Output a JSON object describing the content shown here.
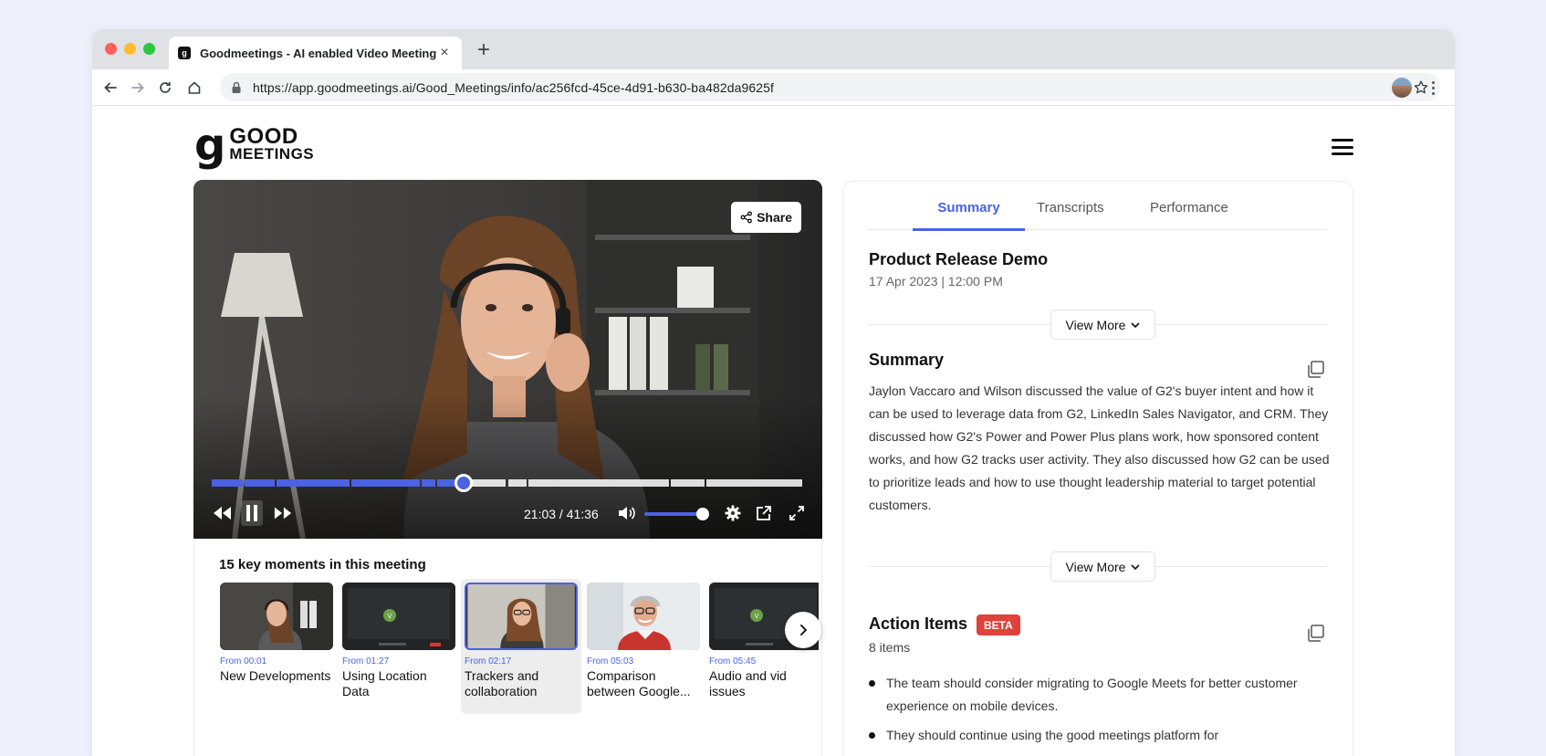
{
  "browser": {
    "tab_title": "Goodmeetings - AI enabled Video Meetings",
    "favicon_letter": "g",
    "tab_close": "×",
    "new_tab": "+",
    "url": "https://app.goodmeetings.ai/Good_Meetings/info/ac256fcd-45ce-4d91-b630-ba482da9625f"
  },
  "brand": {
    "mark": "g",
    "line1": "GOOD",
    "line2": "MEETINGS"
  },
  "video": {
    "share_label": "Share",
    "time": "21:03 / 41:36",
    "progress_fraction": 0.425,
    "volume_fraction": 0.9,
    "accent_color": "#4a62e3"
  },
  "moments": {
    "title": "15 key moments in this meeting",
    "items": [
      {
        "from": "From 00:01",
        "label": "New Developments",
        "thumb": "woman-headset"
      },
      {
        "from": "From 01:27",
        "label": "Using Location Data",
        "thumb": "screen-share"
      },
      {
        "from": "From 02:17",
        "label": "Trackers and collaboration",
        "thumb": "woman-glasses",
        "active": true
      },
      {
        "from": "From 05:03",
        "label": "Comparison between Google...",
        "thumb": "man-glasses"
      },
      {
        "from": "From 05:45",
        "label": "Audio and vid issues",
        "thumb": "screen-share"
      }
    ]
  },
  "panel": {
    "tabs": [
      "Summary",
      "Transcripts",
      "Performance"
    ],
    "active_tab": "Summary",
    "meeting_title": "Product Release Demo",
    "meeting_date": "17 Apr 2023 | 12:00 PM",
    "view_more": "View More",
    "summary_heading": "Summary",
    "summary_text": "Jaylon Vaccaro and Wilson discussed the value of G2's buyer intent and how it can be used to leverage data from G2, LinkedIn Sales Navigator, and CRM. They discussed how G2's Power and Power Plus plans work, how sponsored content works, and how G2 tracks user activity. They also discussed how G2 can be used to prioritize leads and how to use thought leadership material to target potential customers.",
    "action_heading": "Action Items",
    "beta_badge": "BETA",
    "items_count": "8 items",
    "action_items": [
      "The team should consider migrating to Google Meets for better customer experience on mobile devices.",
      "They should continue using the good meetings platform for"
    ]
  }
}
